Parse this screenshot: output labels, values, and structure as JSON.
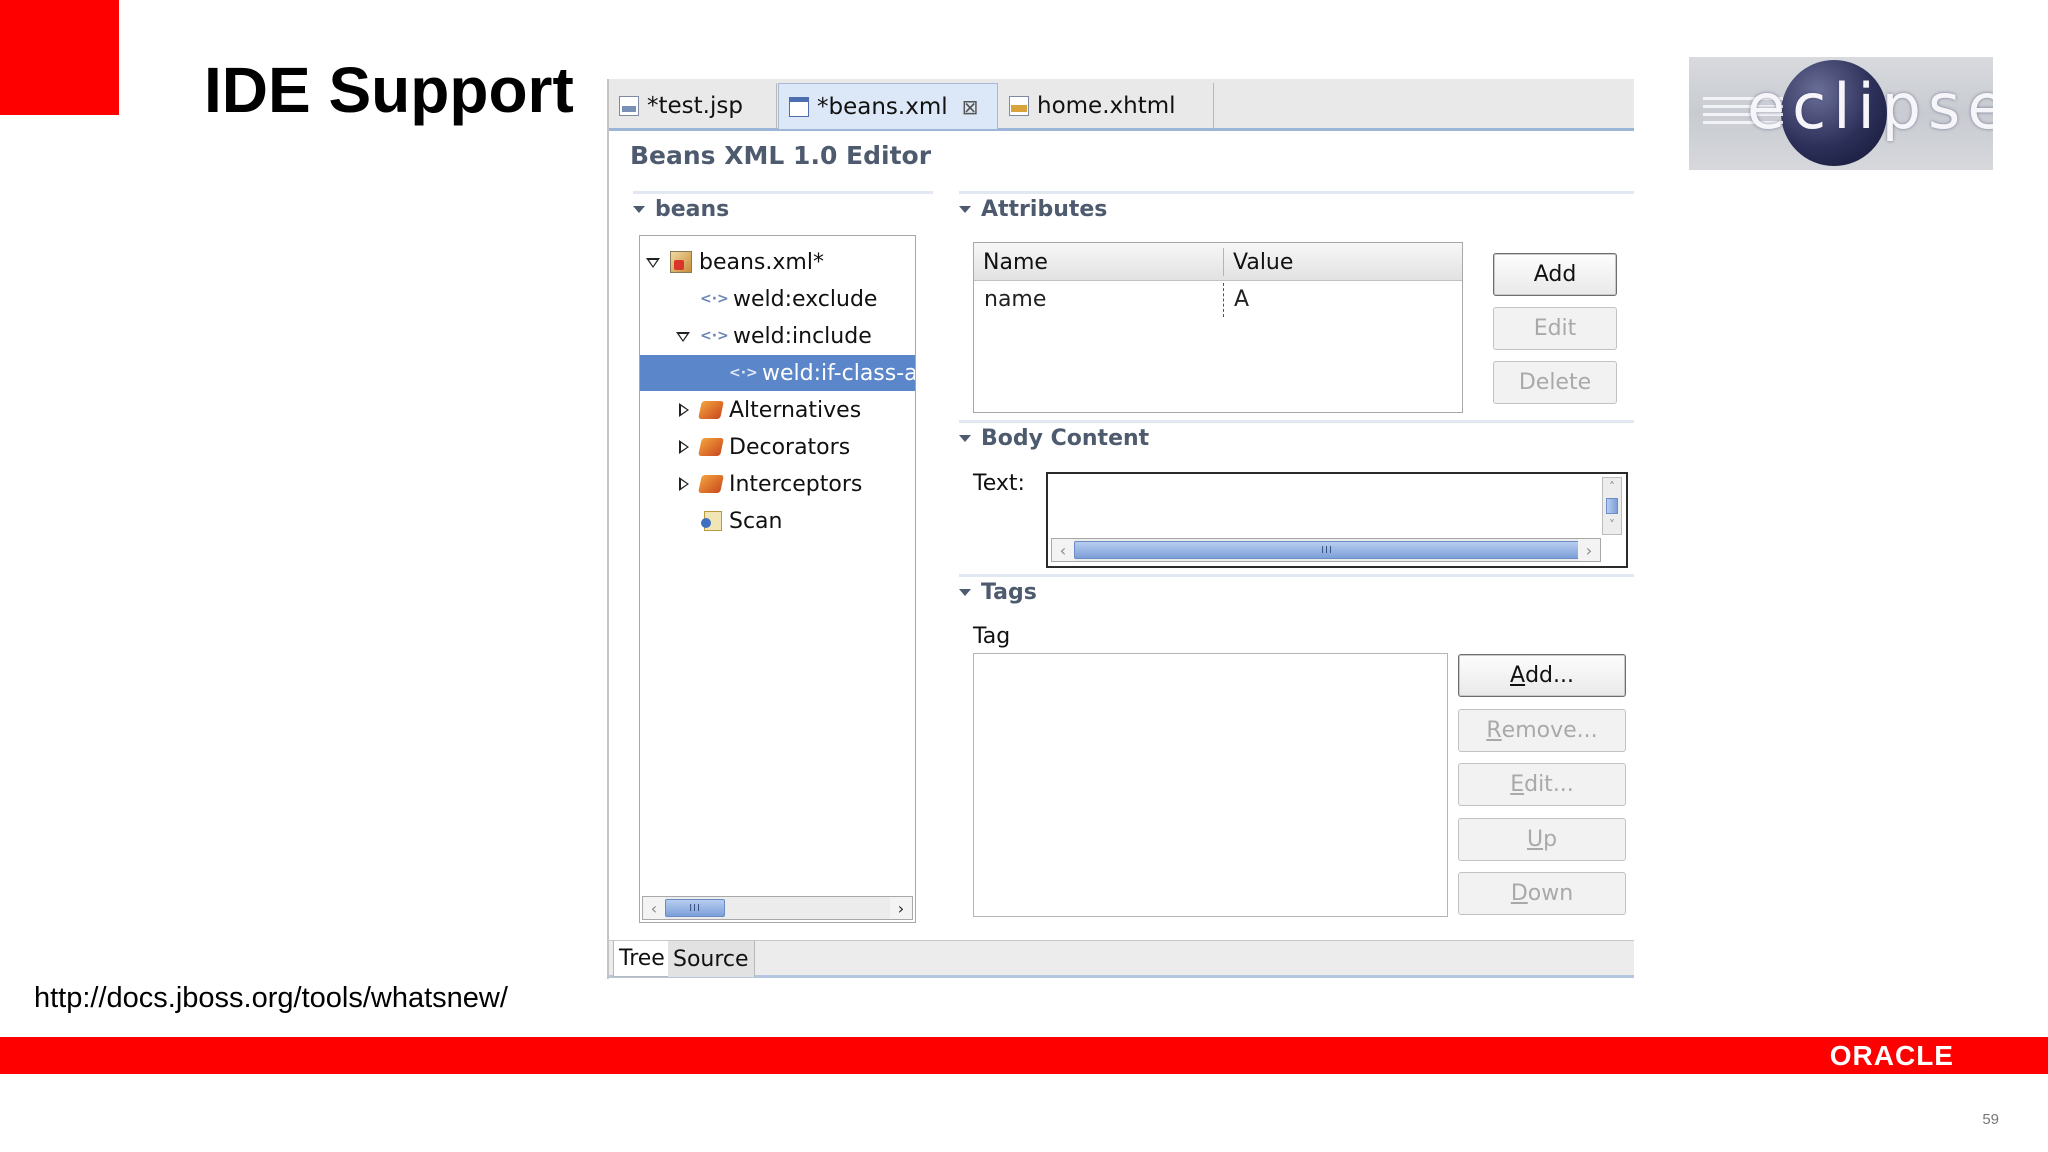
{
  "slide": {
    "title": "IDE Support",
    "url": "http://docs.jboss.org/tools/whatsnew/",
    "oracle_logo": "ORACLE",
    "page_number": "59",
    "brand_red": "#ff0000"
  },
  "eclipse_logo": {
    "text": "eclipse"
  },
  "editor": {
    "tabs": [
      {
        "label": "*test.jsp",
        "icon": "jsp-file-icon"
      },
      {
        "label": "*beans.xml",
        "icon": "xml-file-icon",
        "active": true
      },
      {
        "label": "home.xhtml",
        "icon": "xhtml-file-icon"
      }
    ],
    "close_glyph": "⊠",
    "title": "Beans XML 1.0 Editor",
    "tree": {
      "section": "beans",
      "items": [
        {
          "label": "beans.xml*",
          "icon": "beans-xml-icon",
          "expander": "open"
        },
        {
          "label": "weld:exclude",
          "icon": "xml-tag-icon",
          "expander": "none"
        },
        {
          "label": "weld:include",
          "icon": "xml-tag-icon",
          "expander": "open"
        },
        {
          "label": "weld:if-class-a",
          "icon": "xml-tag-icon",
          "expander": "none",
          "selected": true
        },
        {
          "label": "Alternatives",
          "icon": "alternatives-icon",
          "expander": "closed"
        },
        {
          "label": "Decorators",
          "icon": "decorators-icon",
          "expander": "closed"
        },
        {
          "label": "Interceptors",
          "icon": "interceptors-icon",
          "expander": "closed"
        },
        {
          "label": "Scan",
          "icon": "scan-icon",
          "expander": "none"
        }
      ],
      "tag_glyph": "<·>",
      "scroll_thumb": "III"
    },
    "attributes": {
      "section": "Attributes",
      "columns": [
        "Name",
        "Value"
      ],
      "rows": [
        [
          "name",
          "A"
        ]
      ],
      "buttons": {
        "add": "Add",
        "edit": "Edit",
        "delete": "Delete"
      }
    },
    "body_content": {
      "section": "Body Content",
      "text_label": "Text:",
      "text_value": "",
      "scroll_thumb": "III"
    },
    "tags": {
      "section": "Tags",
      "column_label": "Tag",
      "buttons": [
        {
          "mnemonic": "A",
          "rest": "dd...",
          "enabled": true
        },
        {
          "mnemonic": "R",
          "rest": "emove...",
          "enabled": false
        },
        {
          "mnemonic": "E",
          "rest": "dit...",
          "enabled": false
        },
        {
          "mnemonic": "U",
          "rest": "p",
          "enabled": false
        },
        {
          "mnemonic": "D",
          "rest": "own",
          "enabled": false
        }
      ]
    },
    "bottom_tabs": [
      {
        "label": "Tree",
        "active": true
      },
      {
        "label": "Source",
        "active": false
      }
    ],
    "colors": {
      "selection": "#5b86c9",
      "section_header": "#4e5b6e",
      "active_tab": "#dce8f7"
    }
  }
}
